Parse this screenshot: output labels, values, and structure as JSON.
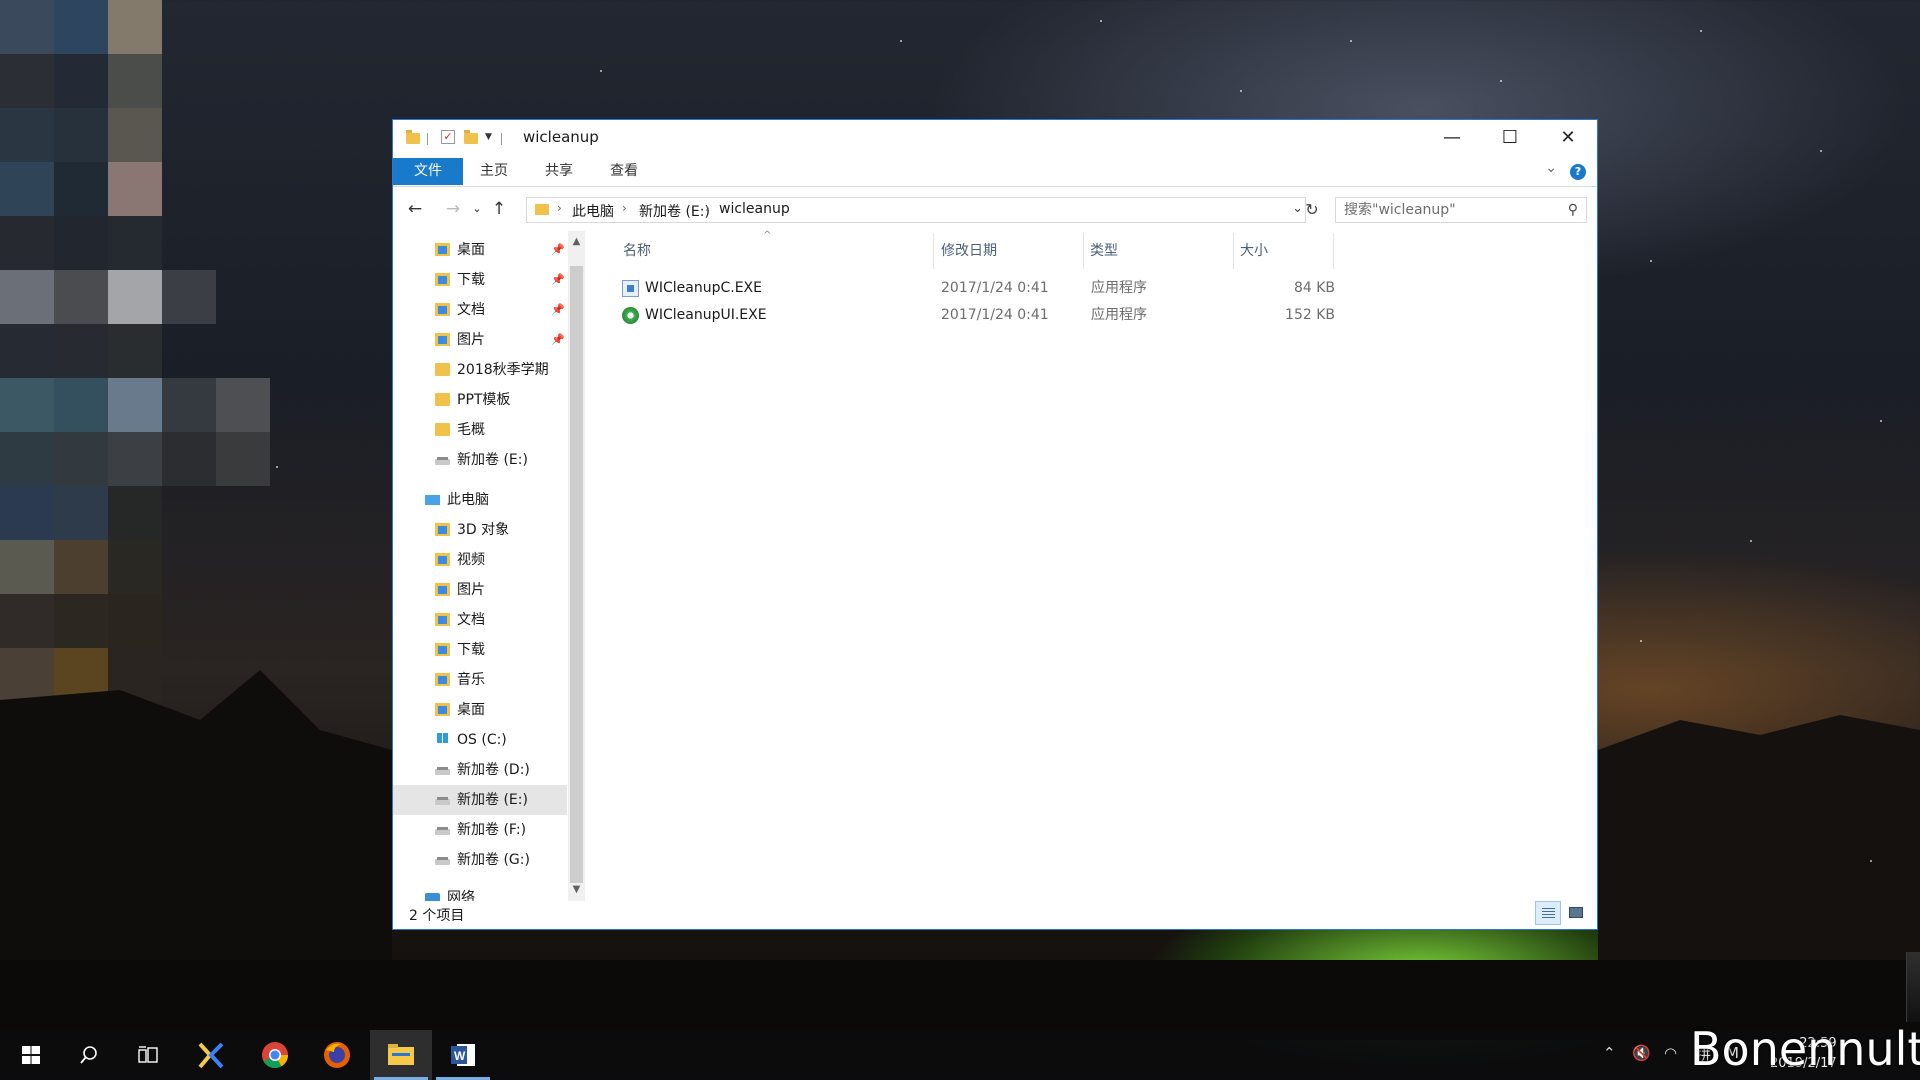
{
  "window": {
    "title": "wicleanup",
    "controls": {
      "minimize": "—",
      "maximize": "☐",
      "close": "✕"
    }
  },
  "ribbon": {
    "tabs": [
      "文件",
      "主页",
      "共享",
      "查看"
    ],
    "help": "?"
  },
  "address": {
    "segments": [
      "此电脑",
      "新加卷 (E:)",
      "wicleanup"
    ],
    "search_placeholder": "搜索\"wicleanup\""
  },
  "nav_pane": {
    "quick_access": [
      {
        "label": "桌面",
        "icon": "desktop-folder-icon",
        "pinned": true
      },
      {
        "label": "下载",
        "icon": "download-folder-icon",
        "pinned": true
      },
      {
        "label": "文档",
        "icon": "documents-folder-icon",
        "pinned": true
      },
      {
        "label": "图片",
        "icon": "pictures-folder-icon",
        "pinned": true
      },
      {
        "label": "2018秋季学期",
        "icon": "folder-icon",
        "pinned": false
      },
      {
        "label": "PPT模板",
        "icon": "folder-icon",
        "pinned": false
      },
      {
        "label": "毛概",
        "icon": "folder-icon",
        "pinned": false
      },
      {
        "label": "新加卷 (E:)",
        "icon": "drive-icon",
        "pinned": false
      }
    ],
    "this_pc": "此电脑",
    "pc_items": [
      {
        "label": "3D 对象",
        "icon": "3d-objects-folder-icon"
      },
      {
        "label": "视频",
        "icon": "videos-folder-icon"
      },
      {
        "label": "图片",
        "icon": "pictures-folder-icon"
      },
      {
        "label": "文档",
        "icon": "documents-folder-icon"
      },
      {
        "label": "下载",
        "icon": "download-folder-icon"
      },
      {
        "label": "音乐",
        "icon": "music-folder-icon"
      },
      {
        "label": "桌面",
        "icon": "desktop-folder-icon"
      },
      {
        "label": "OS (C:)",
        "icon": "os-drive-icon"
      },
      {
        "label": "新加卷 (D:)",
        "icon": "drive-icon"
      },
      {
        "label": "新加卷 (E:)",
        "icon": "drive-icon",
        "selected": true
      },
      {
        "label": "新加卷 (F:)",
        "icon": "drive-icon"
      },
      {
        "label": "新加卷 (G:)",
        "icon": "drive-icon"
      }
    ],
    "network": "网络"
  },
  "columns": [
    "名称",
    "修改日期",
    "类型",
    "大小"
  ],
  "files": [
    {
      "name": "WICleanupC.EXE",
      "modified": "2017/1/24 0:41",
      "type": "应用程序",
      "size": "84 KB",
      "icon": "console-app-icon"
    },
    {
      "name": "WICleanupUI.EXE",
      "modified": "2017/1/24 0:41",
      "type": "应用程序",
      "size": "152 KB",
      "icon": "recycle-app-icon"
    }
  ],
  "status": "2 个项目",
  "taskbar": {
    "apps": [
      "start-icon",
      "search-icon",
      "task-view-icon",
      "xmind-icon",
      "chrome-icon",
      "firefox-icon",
      "file-explorer-icon",
      "word-icon"
    ],
    "active": "file-explorer-icon",
    "clock_time": "22:59",
    "clock_date": "2019/2/17"
  },
  "watermark": "Bonennult"
}
